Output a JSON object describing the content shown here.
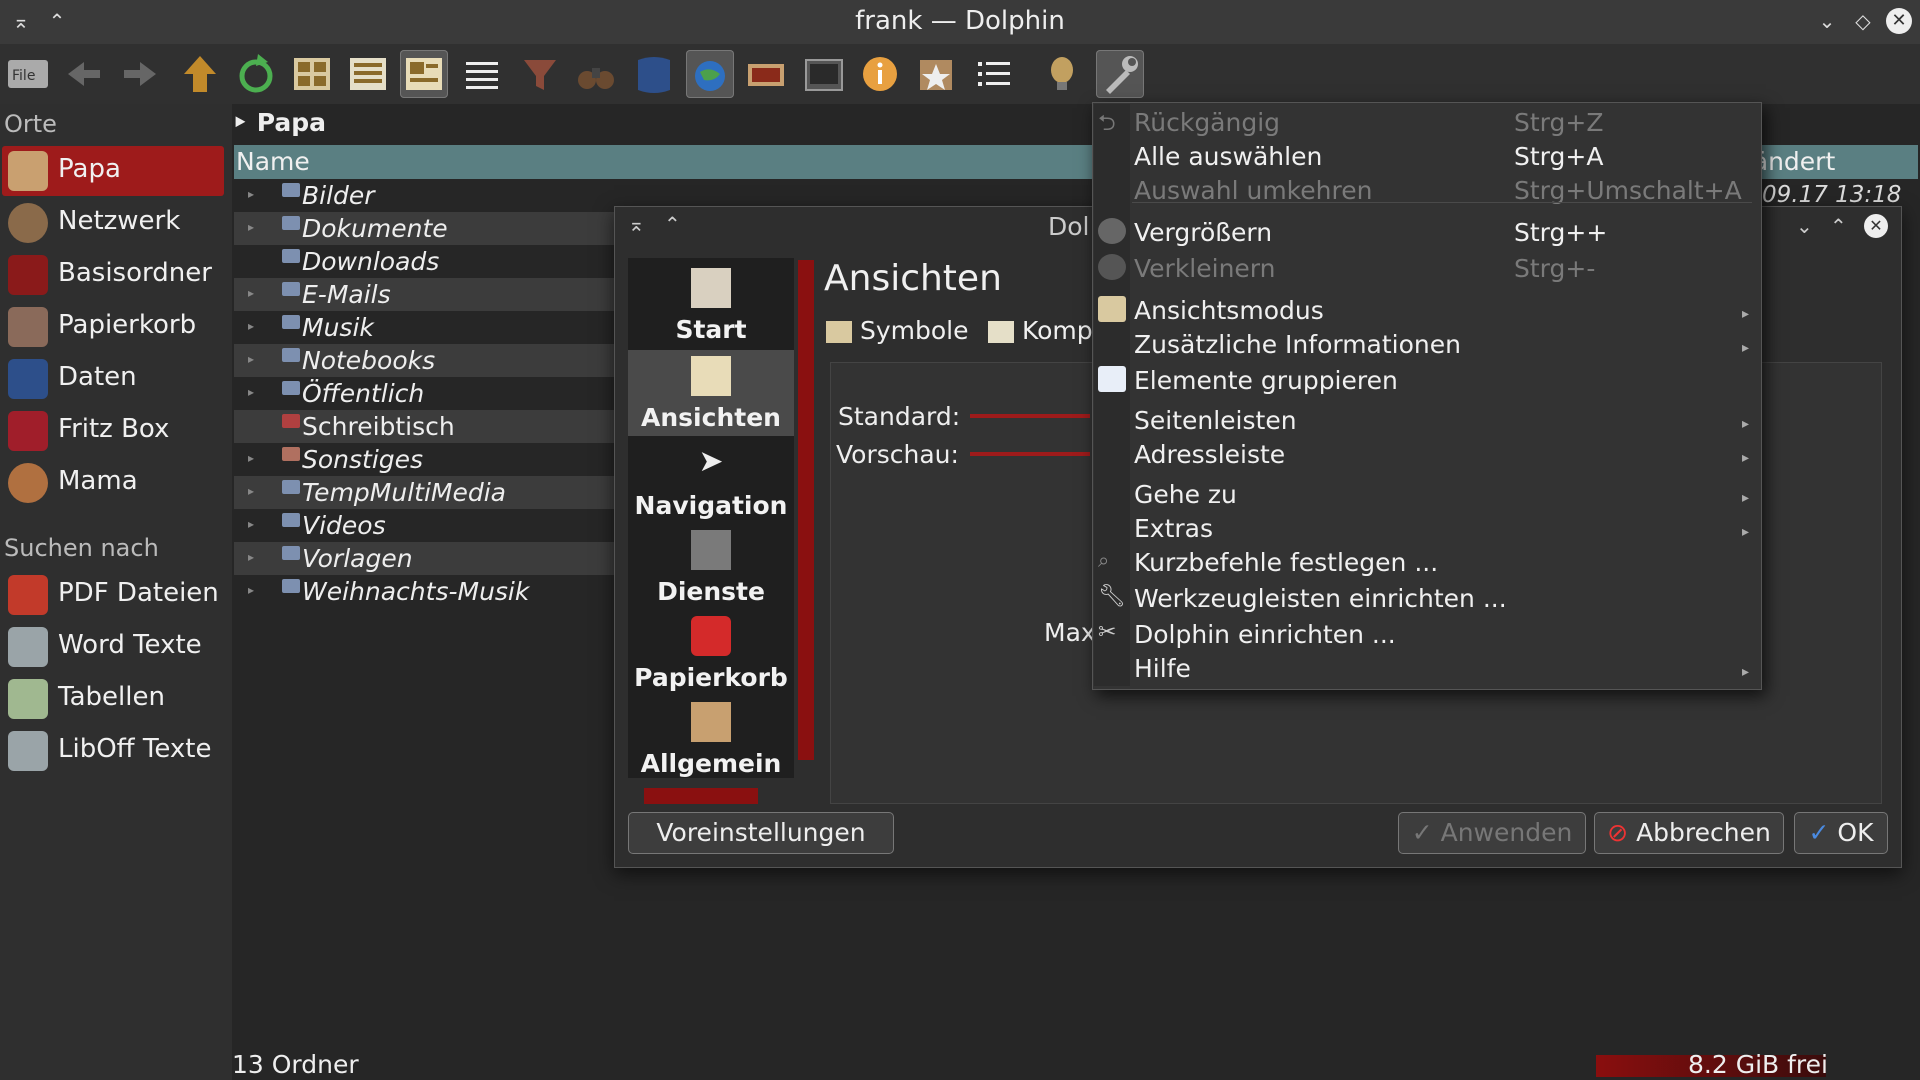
{
  "window": {
    "title": "frank — Dolphin"
  },
  "sidebar": {
    "places_header": "Orte",
    "places": [
      {
        "label": "Papa",
        "icon": "home-bunny-icon",
        "color": "#c9a070"
      },
      {
        "label": "Netzwerk",
        "icon": "network-globe-icon",
        "color": "#8a6a4a"
      },
      {
        "label": "Basisordner",
        "icon": "folder-red-icon",
        "color": "#8a1a1a"
      },
      {
        "label": "Papierkorb",
        "icon": "trash-bin-icon",
        "color": "#8a6a5a"
      },
      {
        "label": "Daten",
        "icon": "drive-blue-icon",
        "color": "#2d4f8a"
      },
      {
        "label": "Fritz Box",
        "icon": "book-red-icon",
        "color": "#a01e2a"
      },
      {
        "label": "Mama",
        "icon": "person-icon",
        "color": "#b07040"
      }
    ],
    "search_header": "Suchen nach",
    "searches": [
      {
        "label": "PDF Dateien",
        "icon": "pdf-document-icon"
      },
      {
        "label": "Word Texte",
        "icon": "text-document-icon"
      },
      {
        "label": "Tabellen",
        "icon": "spreadsheet-icon"
      },
      {
        "label": "LibOff Texte",
        "icon": "text-document-icon"
      }
    ]
  },
  "breadcrumb": {
    "label": "Papa"
  },
  "list": {
    "col_name": "Name",
    "col_modified": "Geändert",
    "modified_partial": "09.17 13:18",
    "files": [
      {
        "name": "Bilder"
      },
      {
        "name": "Dokumente"
      },
      {
        "name": "Downloads"
      },
      {
        "name": "E-Mails"
      },
      {
        "name": "Musik"
      },
      {
        "name": "Notebooks"
      },
      {
        "name": "Öffentlich"
      },
      {
        "name": "Schreibtisch"
      },
      {
        "name": "Sonstiges"
      },
      {
        "name": "TempMultiMedia"
      },
      {
        "name": "Videos"
      },
      {
        "name": "Vorlagen"
      },
      {
        "name": "Weihnachts-Musik"
      }
    ]
  },
  "status": {
    "left": "13 Ordner",
    "free": "8.2 GiB frei"
  },
  "dialog": {
    "title_partial": "Dol",
    "nav": [
      "Start",
      "Ansichten",
      "Navigation",
      "Dienste",
      "Papierkorb",
      "Allgemein"
    ],
    "panel_title": "Ansichten",
    "tab_symbols": "Symbole",
    "tab_compact": "Kompa",
    "label_standard": "Standard:",
    "label_preview": "Vorschau:",
    "label_max": "Max",
    "btn_defaults": "Voreinstellungen",
    "btn_apply": "Anwenden",
    "btn_cancel": "Abbrechen",
    "btn_ok": "OK"
  },
  "menu": {
    "undo": "Rückgängig",
    "undo_sc": "Strg+Z",
    "select_all": "Alle auswählen",
    "select_all_sc": "Strg+A",
    "invert": "Auswahl umkehren",
    "invert_sc": "Strg+Umschalt+A",
    "zoom_in": "Vergrößern",
    "zoom_in_sc": "Strg++",
    "zoom_out": "Verkleinern",
    "zoom_out_sc": "Strg+-",
    "view_mode": "Ansichtsmodus",
    "extra_info": "Zusätzliche Informationen",
    "group": "Elemente gruppieren",
    "panels": "Seitenleisten",
    "location": "Adressleiste",
    "goto": "Gehe zu",
    "extras": "Extras",
    "shortcuts": "Kurzbefehle festlegen ...",
    "toolbars": "Werkzeugleisten einrichten ...",
    "configure": "Dolphin einrichten ...",
    "help": "Hilfe"
  }
}
